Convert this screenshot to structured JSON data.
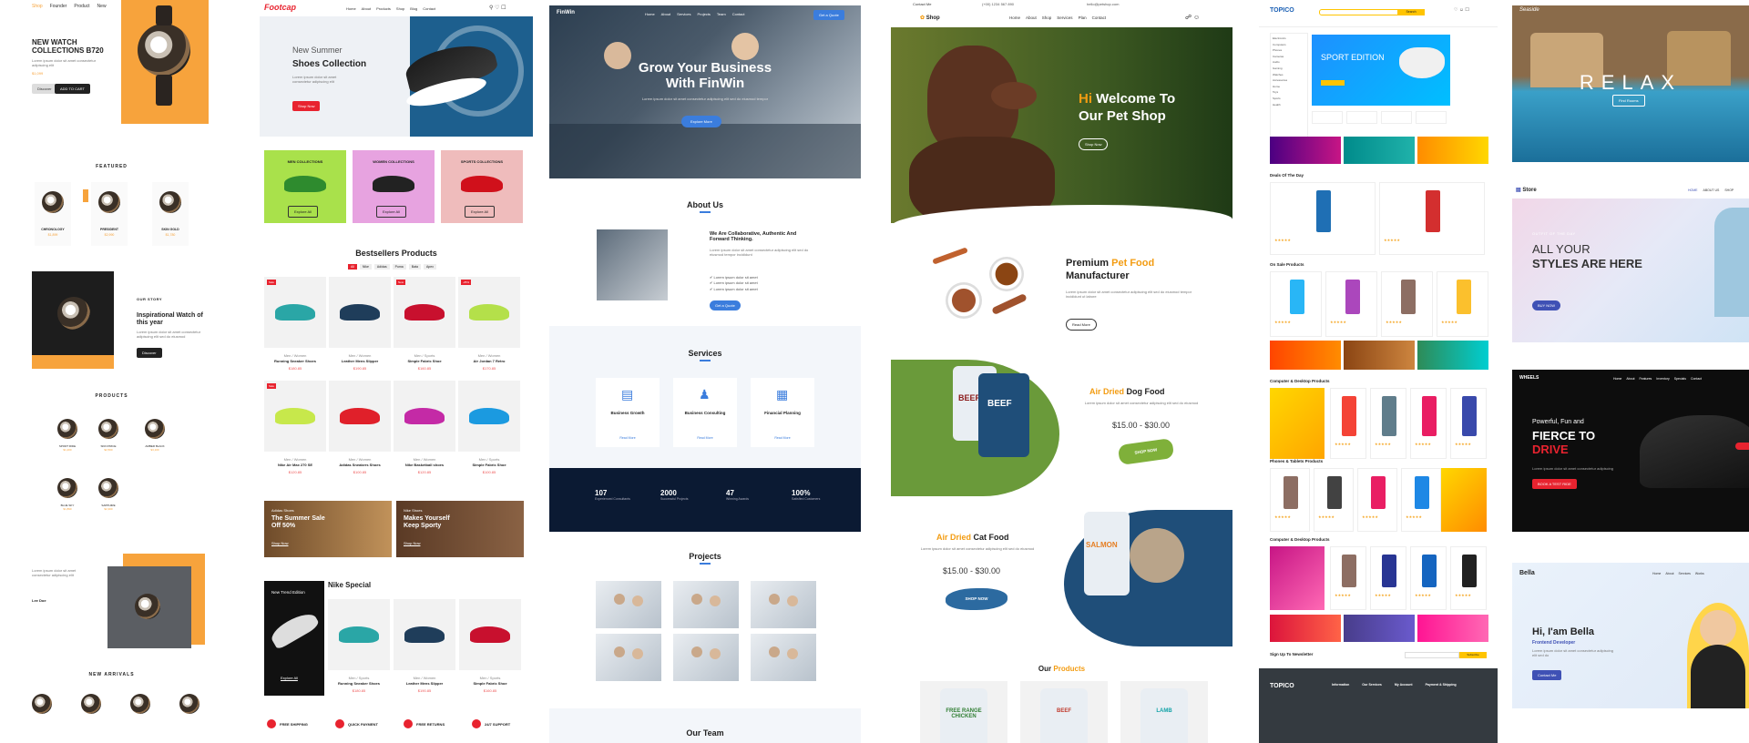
{
  "watches": {
    "nav": [
      "Shop",
      "Founder",
      "Product",
      "New"
    ],
    "hero_title": "NEW WATCH COLLECTIONS B720",
    "hero_price": "$1,099",
    "hero_btn_a": "Discover",
    "hero_btn_b": "ADD TO CART",
    "featured_title": "FEATURED",
    "featured": [
      {
        "name": "CHRONOLOGY",
        "price": "$1,899"
      },
      {
        "name": "PRESIDENT",
        "price": "$2,990"
      },
      {
        "name": "SKIN GOLD",
        "price": "$1,780"
      }
    ],
    "story_label": "OUR STORY",
    "story_title": "Inspirational Watch of this year",
    "story_btn": "Discover",
    "products_title": "PRODUCTS",
    "products": [
      {
        "name": "SPORT RIDE",
        "price": "$1,200"
      },
      {
        "name": "SKIN PRICE",
        "price": "$2,500"
      },
      {
        "name": "AMBER BLACK",
        "price": "$3,100"
      },
      {
        "name": "BLUE SKY",
        "price": "$1,890"
      },
      {
        "name": "SAPPHIRE",
        "price": "$2,300"
      }
    ],
    "author": "Lee Doe",
    "new_arrivals_title": "NEW ARRIVALS"
  },
  "footcap": {
    "brand": "Footcap",
    "nav": [
      "Home",
      "About",
      "Products",
      "Shop",
      "Blog",
      "Contact"
    ],
    "hero_kicker": "New Summer",
    "hero_title": "Shoes Collection",
    "hero_btn": "Shop Now",
    "collections": [
      {
        "title": "MEN COLLECTIONS",
        "btn": "Explore All",
        "color": "#a9e14b"
      },
      {
        "title": "WOMEN COLLECTIONS",
        "btn": "Explore All",
        "color": "#e7a3e0"
      },
      {
        "title": "SPORTS COLLECTIONS",
        "btn": "Explore All",
        "color": "#efbcbc"
      }
    ],
    "bestsellers_title": "Bestsellers Products",
    "filters": [
      "All",
      "Nike",
      "Adidas",
      "Puma",
      "Bata",
      "Apex"
    ],
    "products": [
      {
        "cat": "Men / Women",
        "name": "Running Sneaker Shoes",
        "price": "$180.85",
        "sale": "Sale",
        "color": "#2aa6a6"
      },
      {
        "cat": "Men / Women",
        "name": "Leather Mens Slipper",
        "price": "$190.85",
        "sale": "",
        "color": "#1f3d5a"
      },
      {
        "cat": "Men / Sports",
        "name": "Simple Fabric Shoe",
        "price": "$160.85",
        "sale": "New",
        "color": "#c8102e"
      },
      {
        "cat": "Men / Women",
        "name": "Air Jordan 7 Retro",
        "price": "$170.85",
        "sale": "-25%",
        "color": "#b4e04a"
      },
      {
        "cat": "Men / Women",
        "name": "Nike Air Max 270 SE",
        "price": "$120.85",
        "sale": "Sale",
        "color": "#c7e84b"
      },
      {
        "cat": "Men / Women",
        "name": "Adidas Sneakers Shoes",
        "price": "$100.85",
        "sale": "",
        "color": "#e0202a"
      },
      {
        "cat": "Men / Women",
        "name": "Nike Basketball shoes",
        "price": "$120.85",
        "sale": "",
        "color": "#c42aa6"
      },
      {
        "cat": "Men / Sports",
        "name": "Simple Fabric Shoe",
        "price": "$100.85",
        "sale": "",
        "color": "#1b9ae0"
      }
    ],
    "banner_a_kicker": "Adidas Shoes",
    "banner_a_title": "The Summer Sale Off 50%",
    "banner_a_btn": "Shop Now",
    "banner_b_kicker": "Nike Shoes",
    "banner_b_title": "Makes Yourself Keep Sporty",
    "banner_b_btn": "Shop Now",
    "special_edition": "New Trend Edition",
    "special_btn": "Explore All",
    "special_title": "Nike Special",
    "special_products": [
      {
        "cat": "Men / Sports",
        "name": "Running Sneaker Shoes",
        "price": "$180.85",
        "color": "#2aa6a6"
      },
      {
        "cat": "Men / Women",
        "name": "Leather Mens Slipper",
        "price": "$190.85",
        "color": "#1f3d5a"
      },
      {
        "cat": "Men / Sports",
        "name": "Simple Fabric Shoe",
        "price": "$160.85",
        "color": "#c8102e"
      }
    ],
    "features": [
      "FREE SHIPPING",
      "QUICK PAYMENT",
      "FREE RETURNS",
      "24/7 SUPPORT"
    ]
  },
  "finwin": {
    "brand": "FinWin",
    "nav": [
      "Home",
      "About",
      "Services",
      "Projects",
      "Team",
      "Contact"
    ],
    "nav_btn": "Get a Quote",
    "hero_title_1": "Grow Your Business",
    "hero_title_2": "With FinWin",
    "hero_btn": "Explore More",
    "about_title": "About Us",
    "about_heading": "We Are Collaborative, Authentic And Forward Thinking.",
    "about_btn": "Get a Quote",
    "services_title": "Services",
    "services": [
      "Business Growth",
      "Business Consulting",
      "Financial Planning"
    ],
    "service_link": "Read More",
    "stats": [
      {
        "num": "107",
        "label": "Experienced Consultants"
      },
      {
        "num": "2000",
        "label": "Successful Projects"
      },
      {
        "num": "47",
        "label": "Winning Awards"
      },
      {
        "num": "100%",
        "label": "Satisfied Customers"
      }
    ],
    "projects_title": "Projects",
    "team_title": "Our Team"
  },
  "petshop": {
    "contact": "Contact Me",
    "phone": "(+00) 1234 567 890",
    "email": "hello@petshop.com",
    "brand": "Shop",
    "nav": [
      "Home",
      "About",
      "Shop",
      "Services",
      "Plan",
      "Contact"
    ],
    "hero_hi": "Hi",
    "hero_title_1": "Welcome To",
    "hero_title_2": "Our Pet Shop",
    "hero_btn": "Shop Now",
    "food_title_a": "Premium",
    "food_title_b": "Pet Food",
    "food_title_c": "Manufacturer",
    "food_btn": "Read More",
    "dog_title_a": "Air Dried",
    "dog_title_b": "Dog Food",
    "dog_price": "$15.00 - $30.00",
    "dog_btn": "SHOP NOW",
    "cat_title_a": "Air Dried",
    "cat_title_b": "Cat Food",
    "cat_price": "$15.00 - $30.00",
    "cat_btn": "SHOP NOW",
    "products_title_a": "Our",
    "products_title_b": "Products",
    "bags": [
      {
        "label": "FREE RANGE CHICKEN",
        "color": "#2f7d32"
      },
      {
        "label": "BEEF",
        "color": "#c0392b"
      },
      {
        "label": "LAMB",
        "color": "#12a3a8"
      }
    ],
    "beef_label": "BEEF",
    "salmon_label": "SALMON"
  },
  "topico": {
    "brand": "TOPICO",
    "search_btn": "Search",
    "hero_title": "SPORT EDITION",
    "deals_title": "Deals Of The Day",
    "onsale_title": "On Sale Products",
    "computer_title": "Computer & Desktop Products",
    "phones_title": "Phones & Tablets Products",
    "newsletter": "Sign Up To Newsletter",
    "newsletter_btn": "Subscribe",
    "footer_cols": [
      "Information",
      "Our Services",
      "My Account",
      "Payment & Shipping"
    ]
  },
  "seaside": {
    "brand": "Seaside",
    "hero_title": "RELAX",
    "hero_btn": "Find Rooms"
  },
  "store": {
    "brand": "Store",
    "nav": [
      "HOME",
      "ABOUT US",
      "SHOP"
    ],
    "kicker": "OUTFIT OF THE DAY",
    "title_1": "ALL YOUR",
    "title_2": "STYLES ARE HERE",
    "btn": "BUY NOW"
  },
  "wheels": {
    "brand": "WHEELS",
    "nav": [
      "Home",
      "About",
      "Features",
      "Inventory",
      "Specials",
      "Contact"
    ],
    "title_1": "Powerful, Fun and",
    "title_2": "FIERCE TO",
    "title_3": "DRIVE",
    "btn": "BOOK A TEST RIDE"
  },
  "bella": {
    "brand": "Bella",
    "nav": [
      "Home",
      "About",
      "Services",
      "Works"
    ],
    "title": "Hi, I'am Bella",
    "role": "Frontend Developer",
    "btn": "Contact Me"
  },
  "colors": {
    "orange": "#f7a33c",
    "blue_dark": "#0b1a33",
    "pet_orange": "#f39c12",
    "topico_yellow": "#ffc400",
    "red": "#e8232f"
  }
}
